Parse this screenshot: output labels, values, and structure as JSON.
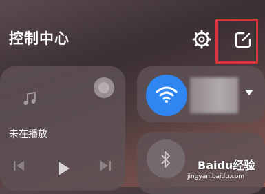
{
  "header": {
    "title": "控制中心",
    "settings_icon": "gear-icon",
    "edit_icon": "edit-icon",
    "highlight_color": "#d6353b"
  },
  "media": {
    "status": "未在播放",
    "icons": [
      "music-note-icon",
      "cast-icon",
      "previous-icon",
      "play-icon",
      "next-icon"
    ]
  },
  "wifi": {
    "icon": "wifi-icon",
    "accent_color": "#2f86f0",
    "network_name_redacted": true
  },
  "bluetooth": {
    "icon": "bluetooth-icon"
  },
  "watermark": {
    "text": "Baidu经验",
    "url": "jingyan.baidu.com"
  }
}
